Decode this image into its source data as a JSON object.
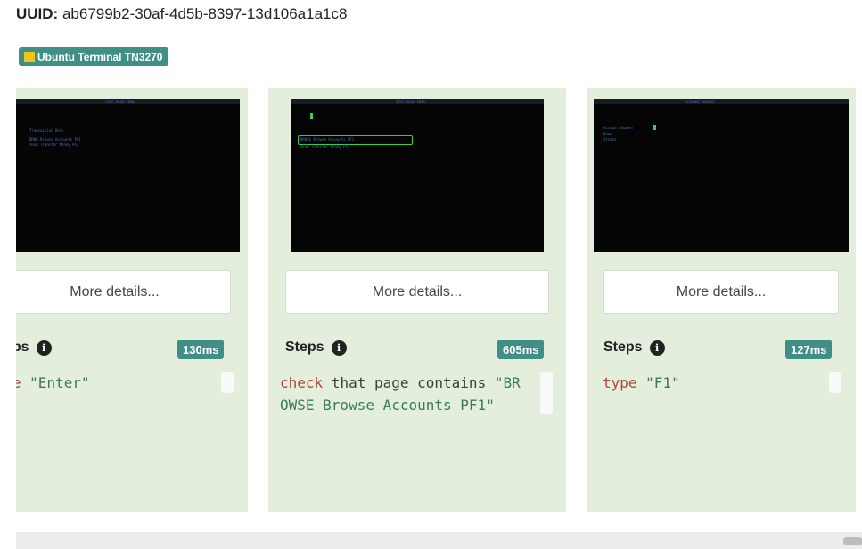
{
  "header": {
    "uuid_label": "UUID:",
    "uuid_value": "ab6799b2-30af-4d5b-8397-13d106a1a1c8"
  },
  "tag": {
    "label": "Ubuntu Terminal TN3270",
    "icon": "yellow-square-icon",
    "color": "#3f8f86"
  },
  "cards": [
    {
      "terminal": {
        "title": "CICS MAIN MENU",
        "lines": [
          "Transaction   Desc",
          "BRWS  Browse Accounts  PF1",
          "XFER  Transfer Money   PF2"
        ]
      },
      "details_label": "More details...",
      "steps_label": "Steps",
      "duration": "130ms",
      "code": {
        "keyword": "type",
        "text": " ",
        "string": "\"Enter\""
      }
    },
    {
      "terminal": {
        "title": "CICS MAIN MENU",
        "lines": [
          "BRWSE  Browse Accounts  PF1",
          "XFER   Transfer Money   PF2"
        ]
      },
      "details_label": "More details...",
      "steps_label": "Steps",
      "duration": "605ms",
      "code": {
        "keyword": "check",
        "text": " that page contains ",
        "string": "\"BR",
        "string_cont": "OWSE Browse Accounts PF1\""
      }
    },
    {
      "terminal": {
        "title": "ACCOUNT BROWSE",
        "lines": [
          "Account Number",
          "Name",
          "Status"
        ]
      },
      "details_label": "More details...",
      "steps_label": "Steps",
      "duration": "127ms",
      "code": {
        "keyword": "type",
        "text": " ",
        "string": "\"F1\""
      }
    }
  ],
  "colors": {
    "card_bg": "#e3eedc",
    "badge": "#3f8f86",
    "keyword": "#b2463a",
    "string": "#3c7a5a"
  }
}
